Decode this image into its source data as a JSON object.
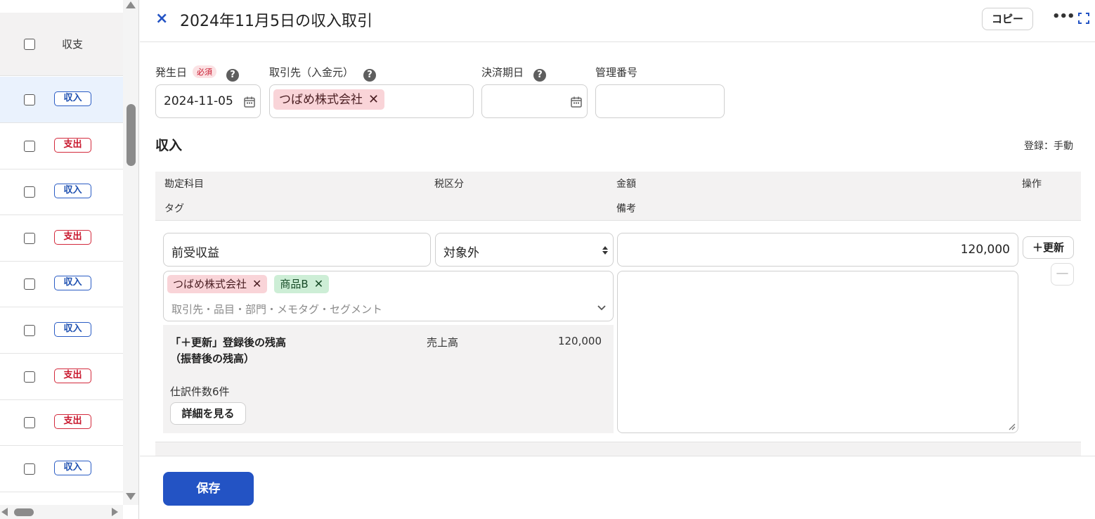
{
  "list": {
    "header_label": "収支",
    "rows": [
      {
        "type": "収入",
        "kind": "in",
        "selected": true
      },
      {
        "type": "支出",
        "kind": "out"
      },
      {
        "type": "収入",
        "kind": "in"
      },
      {
        "type": "支出",
        "kind": "out"
      },
      {
        "type": "収入",
        "kind": "in"
      },
      {
        "type": "収入",
        "kind": "in"
      },
      {
        "type": "支出",
        "kind": "out"
      },
      {
        "type": "支出",
        "kind": "out"
      },
      {
        "type": "収入",
        "kind": "in"
      }
    ]
  },
  "header": {
    "close_icon": "×",
    "title": "2024年11月5日の収入取引",
    "copy_label": "コピー",
    "more_icon": "•••"
  },
  "form": {
    "date_label": "発生日",
    "required_label": "必須",
    "help_icon": "?",
    "date_value": "2024-11-05",
    "partner_label": "取引先（入金元）",
    "partner_chip": "つばめ株式会社",
    "due_label": "決済期日",
    "due_value": "",
    "mgmt_label": "管理番号",
    "mgmt_value": ""
  },
  "section": {
    "title": "収入",
    "registration": "登録：手動"
  },
  "table": {
    "col_account": "勘定科目",
    "col_tax": "税区分",
    "col_amount": "金額",
    "col_action": "操作",
    "col_tag": "タグ",
    "col_note": "備考"
  },
  "line": {
    "account": "前受収益",
    "tax": "対象外",
    "amount": "120,000",
    "add_label": "＋更新",
    "minus_label": "—",
    "tag_chips": [
      {
        "label": "つばめ株式会社",
        "color": "red"
      },
      {
        "label": "商品B",
        "color": "green"
      }
    ],
    "tag_placeholder": "取引先・品目・部門・メモタグ・セグメント",
    "note": ""
  },
  "balance": {
    "label_line1": "「＋更新」登録後の残高",
    "label_line2": "（振替後の残高）",
    "account": "売上高",
    "amount": "120,000",
    "count": "仕訳件数6件",
    "detail_button": "詳細を見る"
  },
  "footer": {
    "save_label": "保存"
  },
  "colors": {
    "primary": "#2353c4",
    "income": "#1d4fb0",
    "expense": "#c8162c",
    "chip_red": "#f9d4d8",
    "chip_green": "#cdeed6"
  }
}
